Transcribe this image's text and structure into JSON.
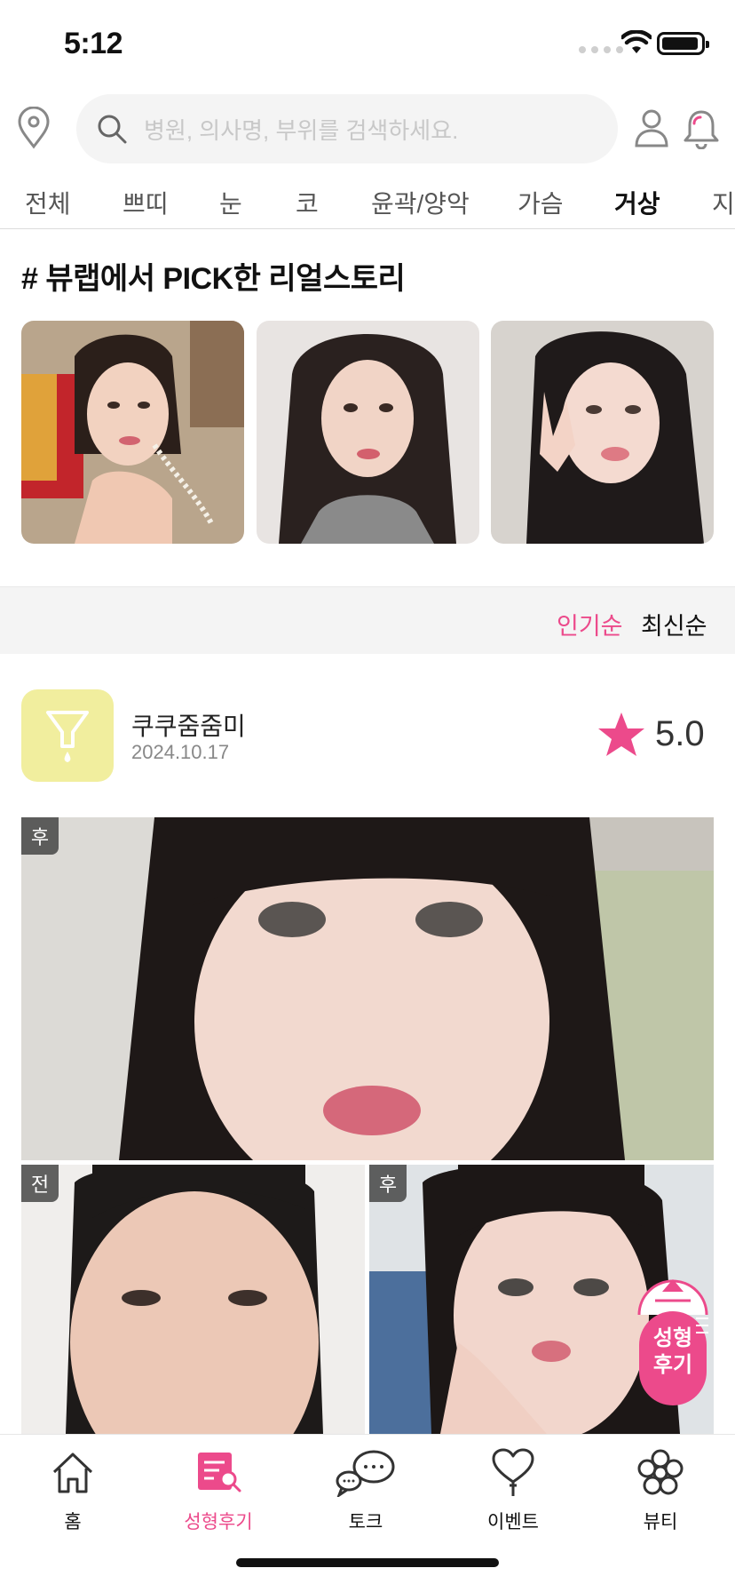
{
  "status_bar": {
    "time": "5:12"
  },
  "search": {
    "placeholder": "병원, 의사명, 부위를 검색하세요."
  },
  "tabs": [
    {
      "label": "전체"
    },
    {
      "label": "쁘띠"
    },
    {
      "label": "눈"
    },
    {
      "label": "코"
    },
    {
      "label": "윤곽/양악"
    },
    {
      "label": "가슴"
    },
    {
      "label": "거상",
      "active": true
    },
    {
      "label": "지방"
    }
  ],
  "section_title": "# 뷰랩에서 PICK한 리얼스토리",
  "sort": {
    "popular": "인기순",
    "latest": "최신순"
  },
  "post": {
    "username": "쿠쿠줌줌미",
    "date": "2024.10.17",
    "rating": "5.0",
    "badges": {
      "main": "후",
      "before": "전",
      "after": "후"
    }
  },
  "floating_button": {
    "line1": "성형",
    "line2": "후기"
  },
  "bottom_nav": [
    {
      "label": "홈",
      "icon": "home-icon"
    },
    {
      "label": "성형후기",
      "icon": "review-icon",
      "active": true
    },
    {
      "label": "토크",
      "icon": "chat-icon"
    },
    {
      "label": "이벤트",
      "icon": "heart-balloon-icon"
    },
    {
      "label": "뷰티",
      "icon": "flower-icon"
    }
  ],
  "colors": {
    "accent": "#ec4a8b",
    "avatar_bg": "#f1ee9e"
  }
}
